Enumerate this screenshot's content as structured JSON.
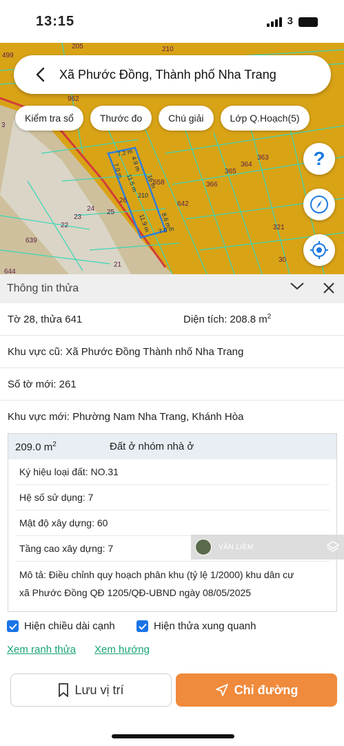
{
  "status_bar": {
    "time": "13:15",
    "network": "3",
    "battery": ""
  },
  "search": {
    "title": "Xã Phước Đồng, Thành phố Nha Trang"
  },
  "chips": [
    {
      "label": "Kiểm tra sổ"
    },
    {
      "label": "Thước đo"
    },
    {
      "label": "Chú giải"
    },
    {
      "label": "Lớp Q.Hoạch(5)"
    }
  ],
  "map": {
    "parcel_labels": [
      "499",
      "205",
      "210",
      "962",
      "3",
      "658",
      "366",
      "365",
      "364",
      "363",
      "642",
      "26",
      "24",
      "25",
      "23",
      "22",
      "639",
      "321",
      "21",
      "30",
      "644"
    ],
    "edge_labels": [
      "7.2 m",
      "4.9 m",
      "7.0 m",
      "16 m",
      "210",
      "11.5 m",
      "11.9 m",
      "8.6 m",
      "7.0 m"
    ],
    "colors": {
      "land": "#d9a316",
      "boundary": "#39d6b8",
      "selected": "#2f7fd9"
    }
  },
  "panel": {
    "title": "Thông tin thửa",
    "sheet_parcel": "Tờ 28, thửa 641",
    "area_label": "Diện tích: 208.8 m",
    "area_sup": "2",
    "old_area": "Khu vực cũ: Xã Phước Đồng  Thành nhố Nha Trang",
    "new_sheet": "Số tờ mới: 261",
    "new_area": "Khu vực mới: Phường Nam Nha Trang, Khánh Hòa"
  },
  "zone": {
    "area_value": "209.0 m",
    "area_sup": "2",
    "land_type": "Đất ở nhóm nhà ở",
    "symbol": "Ký hiệu loại đất: NO.31",
    "usage_ratio": "Hệ số sử dụng: 7",
    "density": "Mật độ xây dựng: 60",
    "floors": "Tầng cao xây dựng: 7",
    "description_1": "Mô tả: Điều chỉnh quy hoạch phân khu (tỷ lệ 1/2000) khu dân cư",
    "description_2": "xã Phước Đồng QĐ 1205/QĐ-UBND ngày 08/05/2025"
  },
  "watermark": {
    "text": "VĂN LIÊM"
  },
  "options": {
    "show_edge_length": "Hiện chiều dài cạnh",
    "show_neighbors": "Hiện thửa xung quanh"
  },
  "links": {
    "view_boundary": "Xem ranh thửa",
    "view_direction": "Xem hướng"
  },
  "buttons": {
    "save_location": "Lưu vị trí",
    "directions": "Chỉ đường"
  },
  "accent": {
    "primary": "#1a73e8",
    "route_button": "#f08a3c",
    "link": "#17a374"
  }
}
